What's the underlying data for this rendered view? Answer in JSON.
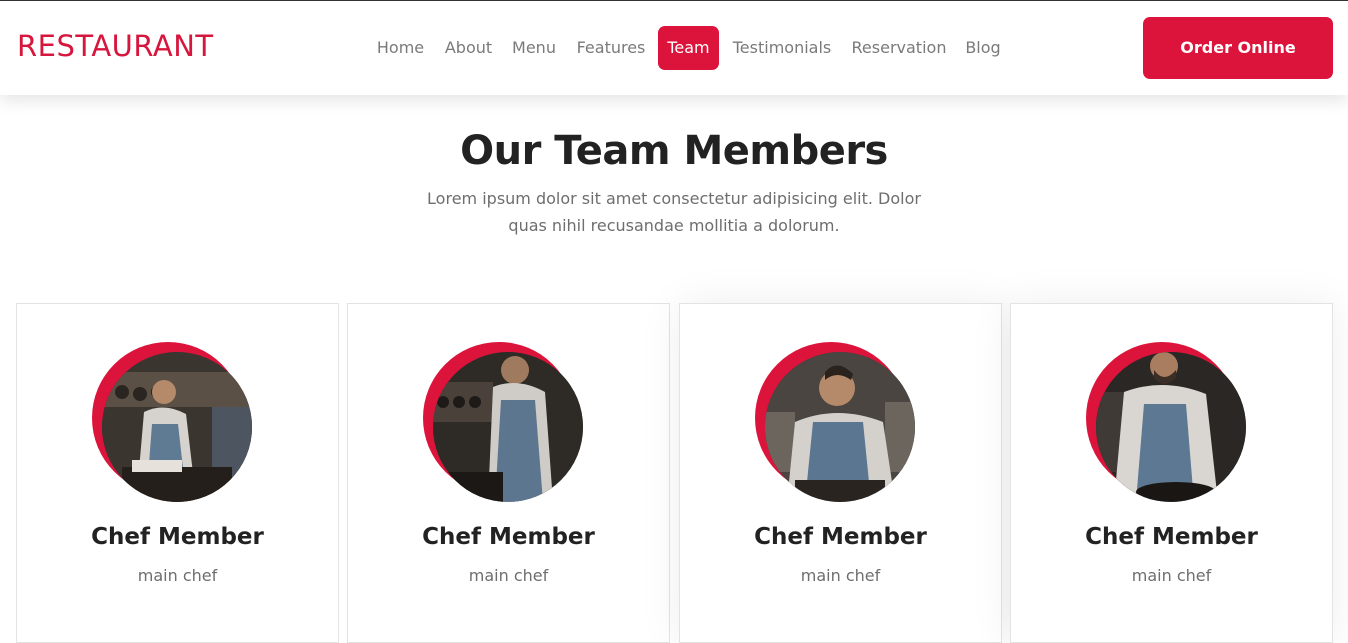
{
  "header": {
    "logo": "RESTAURANT",
    "nav": [
      {
        "label": "Home"
      },
      {
        "label": "About"
      },
      {
        "label": "Menu"
      },
      {
        "label": "Features"
      },
      {
        "label": "Team"
      },
      {
        "label": "Testimonials"
      },
      {
        "label": "Reservation"
      },
      {
        "label": "Blog"
      }
    ],
    "active_nav": "Team",
    "order_button": "Order Online"
  },
  "team": {
    "title": "Our Team Members",
    "subtitle": "Lorem ipsum dolor sit amet consectetur adipisicing elit. Dolor quas nihil recusandae mollitia a dolorum.",
    "members": [
      {
        "name": "Chef Member",
        "role": "main chef",
        "photo_icon": "chef-photo"
      },
      {
        "name": "Chef Member",
        "role": "main chef",
        "photo_icon": "chef-photo"
      },
      {
        "name": "Chef Member",
        "role": "main chef",
        "photo_icon": "chef-photo"
      },
      {
        "name": "Chef Member",
        "role": "main chef",
        "photo_icon": "chef-photo"
      }
    ]
  },
  "colors": {
    "accent": "#dc143c",
    "logo": "#d6163d",
    "text_dark": "#222222",
    "text_muted": "#6e6e6e"
  }
}
